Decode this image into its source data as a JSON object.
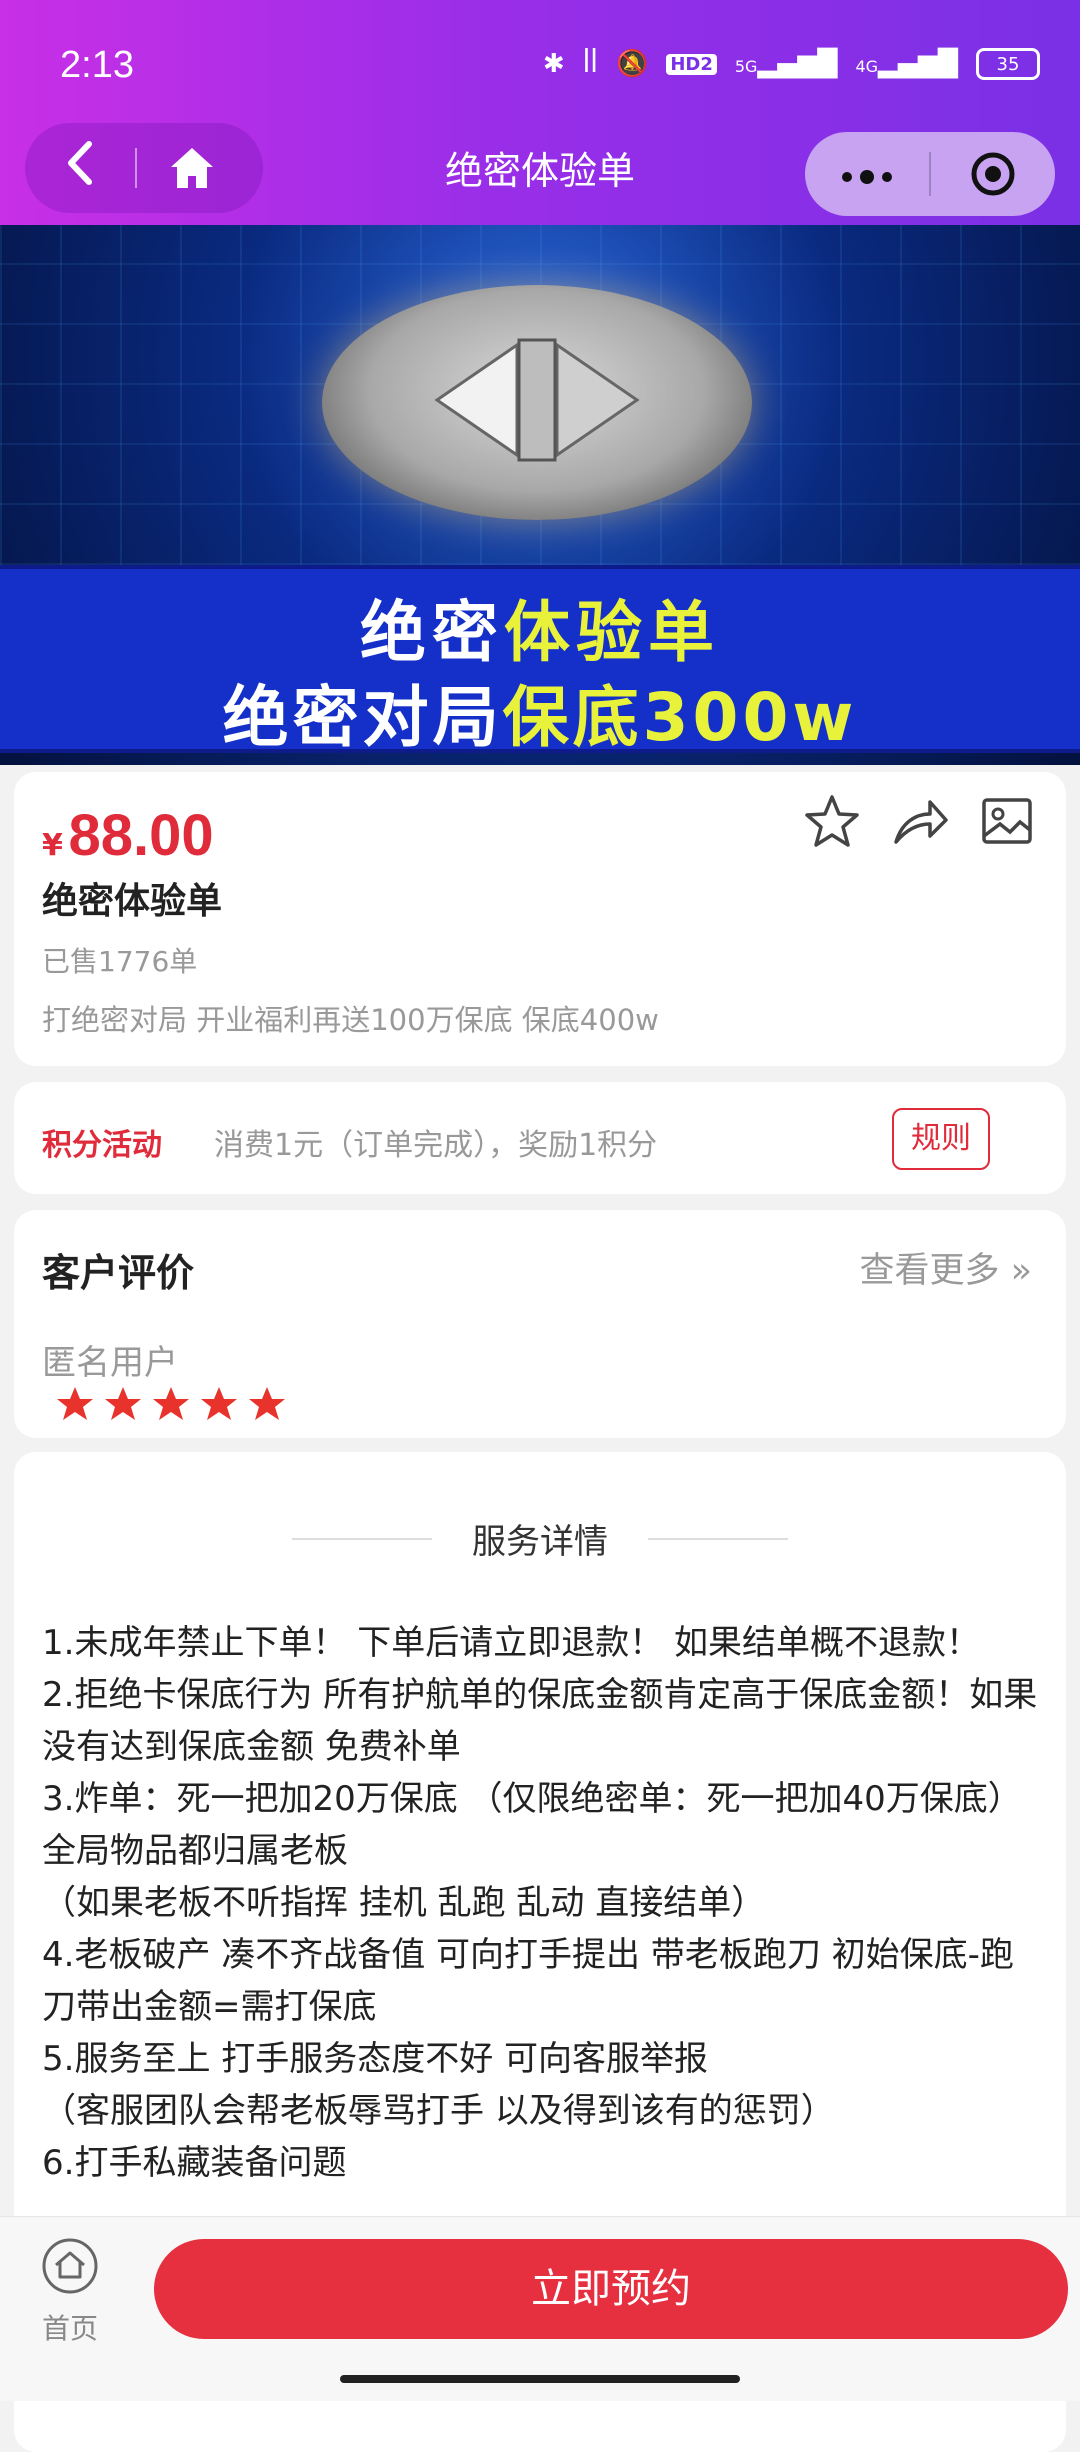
{
  "status_bar": {
    "time": "2:13",
    "signal_5g": "5G",
    "signal_4g": "4G",
    "hd": "HD2",
    "battery": "35"
  },
  "nav": {
    "title": "绝密体验单",
    "more_icon": "more-dots-icon",
    "target_icon": "target-icon"
  },
  "banner": {
    "line1_part1": "绝密",
    "line1_part2": "体验单",
    "line2_part1": "绝密对局",
    "line2_part2": "保底300w"
  },
  "product": {
    "currency": "¥",
    "price": "88.00",
    "name": "绝密体验单",
    "sold": "已售1776单",
    "description": "打绝密对局 开业福利再送100万保底 保底400w"
  },
  "points": {
    "label": "积分活动",
    "description": "消费1元（订单完成），奖励1积分",
    "rules": "规则"
  },
  "reviews": {
    "title": "客户评价",
    "more": "查看更多 »",
    "reviewer": "匿名用户",
    "rating": 5
  },
  "detail": {
    "title": "服务详情",
    "lines": [
      "1.未成年禁止下单！ 下单后请立即退款！ 如果结单概不退款！",
      "2.拒绝卡保底行为 所有护航单的保底金额肯定高于保底金额！如果没有达到保底金额 免费补单",
      "3.炸单：死一把加20万保底 （仅限绝密单：死一把加40万保底）全局物品都归属老板",
      "（如果老板不听指挥 挂机 乱跑 乱动 直接结单）",
      "4.老板破产 凑不齐战备值 可向打手提出 带老板跑刀 初始保底-跑刀带出金额=需打保底",
      "5.服务至上 打手服务态度不好 可向客服举报",
      "（客服团队会帮老板辱骂打手 以及得到该有的惩罚）",
      "6.打手私藏装备问题"
    ]
  },
  "bottom": {
    "home_label": "首页",
    "book_label": "立即预约"
  },
  "colors": {
    "accent_red": "#e62f3f",
    "header_purple": "#9a2ee8",
    "star": "#e8322c"
  }
}
